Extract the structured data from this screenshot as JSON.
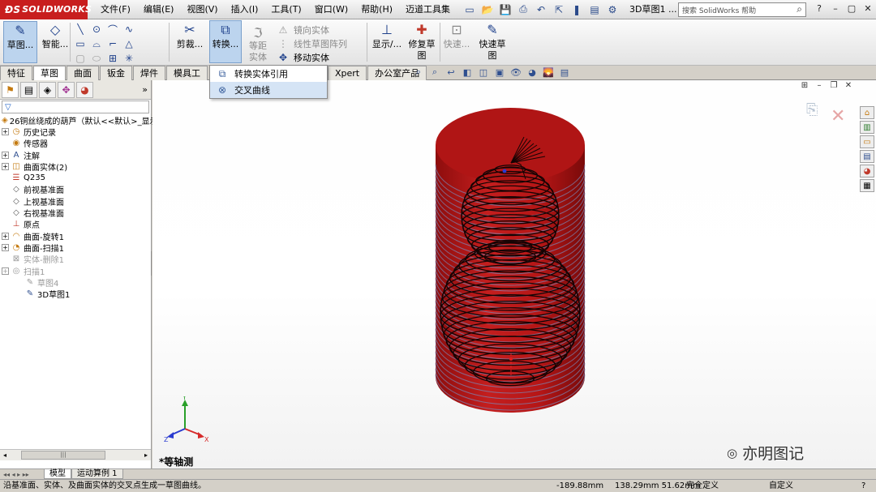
{
  "app": {
    "brand": "SOLIDWORKS",
    "window_title": "3D草图1 ...",
    "menu": [
      "文件(F)",
      "编辑(E)",
      "视图(V)",
      "插入(I)",
      "工具(T)",
      "窗口(W)",
      "帮助(H)",
      "迈道工具集"
    ],
    "search_placeholder": "搜索 SolidWorks 帮助"
  },
  "ribbon": {
    "sketch": "草图...",
    "smart": "智能...",
    "trim": "剪裁...",
    "convert": "转换...",
    "offset": "等距实体",
    "mirror": "镜向实体",
    "linear_pattern": "线性草图阵列",
    "move": "移动实体",
    "display": "显示/...",
    "repair": "修复草图",
    "quick": "快速...",
    "quick_sketch": "快速草图"
  },
  "tabs": [
    "特征",
    "草图",
    "曲面",
    "钣金",
    "焊件",
    "模具工"
  ],
  "tabs_right": [
    "Xpert",
    "办公室产品"
  ],
  "active_tab_index": 1,
  "dropdown": {
    "items": [
      {
        "label": "转换实体引用",
        "icon": "convert-entities-icon"
      },
      {
        "label": "交叉曲线",
        "icon": "intersection-curve-icon"
      }
    ],
    "hover_index": 1
  },
  "tree": {
    "root": "26铜丝绕成的葫芦（默认<<默认>_显示",
    "items": [
      {
        "label": "历史记录",
        "icon": "history-icon",
        "expandable": true,
        "indent": 0,
        "dim": false
      },
      {
        "label": "传感器",
        "icon": "sensor-icon",
        "expandable": false,
        "indent": 0,
        "dim": false
      },
      {
        "label": "注解",
        "icon": "annotation-icon",
        "expandable": true,
        "indent": 0,
        "dim": false
      },
      {
        "label": "曲面实体(2)",
        "icon": "surface-bodies-icon",
        "expandable": true,
        "indent": 0,
        "dim": false
      },
      {
        "label": "Q235",
        "icon": "material-icon",
        "expandable": false,
        "indent": 0,
        "dim": false
      },
      {
        "label": "前视基准面",
        "icon": "plane-icon",
        "expandable": false,
        "indent": 0,
        "dim": false
      },
      {
        "label": "上视基准面",
        "icon": "plane-icon",
        "expandable": false,
        "indent": 0,
        "dim": false
      },
      {
        "label": "右视基准面",
        "icon": "plane-icon",
        "expandable": false,
        "indent": 0,
        "dim": false
      },
      {
        "label": "原点",
        "icon": "origin-icon",
        "expandable": false,
        "indent": 0,
        "dim": false
      },
      {
        "label": "曲面-旋转1",
        "icon": "revolve-surface-icon",
        "expandable": true,
        "indent": 0,
        "dim": false
      },
      {
        "label": "曲面-扫描1",
        "icon": "sweep-surface-icon",
        "expandable": true,
        "indent": 0,
        "dim": false
      },
      {
        "label": "实体-删除1",
        "icon": "delete-body-icon",
        "expandable": false,
        "indent": 0,
        "dim": true
      },
      {
        "label": "扫描1",
        "icon": "sweep-icon",
        "expandable": true,
        "indent": 0,
        "dim": true
      },
      {
        "label": "草图4",
        "icon": "sketch-icon",
        "expandable": false,
        "indent": 1,
        "dim": true
      },
      {
        "label": "3D草图1",
        "icon": "sketch3d-icon",
        "expandable": false,
        "indent": 1,
        "dim": false
      }
    ]
  },
  "view": {
    "orientation": "*等轴测",
    "triad": {
      "x": "X",
      "y": "Y",
      "z": "Z"
    },
    "watermark": "亦明图记",
    "model_color": "#b31616"
  },
  "bottom_tabs": [
    "模型",
    "运动算例 1"
  ],
  "status": {
    "message": "沿基准面、实体、及曲面实体的交叉点生成一草图曲线。",
    "coord1": "-189.88mm",
    "coord2": "138.29mm 51.62mm",
    "state": "完全定义",
    "units": "自定义"
  }
}
